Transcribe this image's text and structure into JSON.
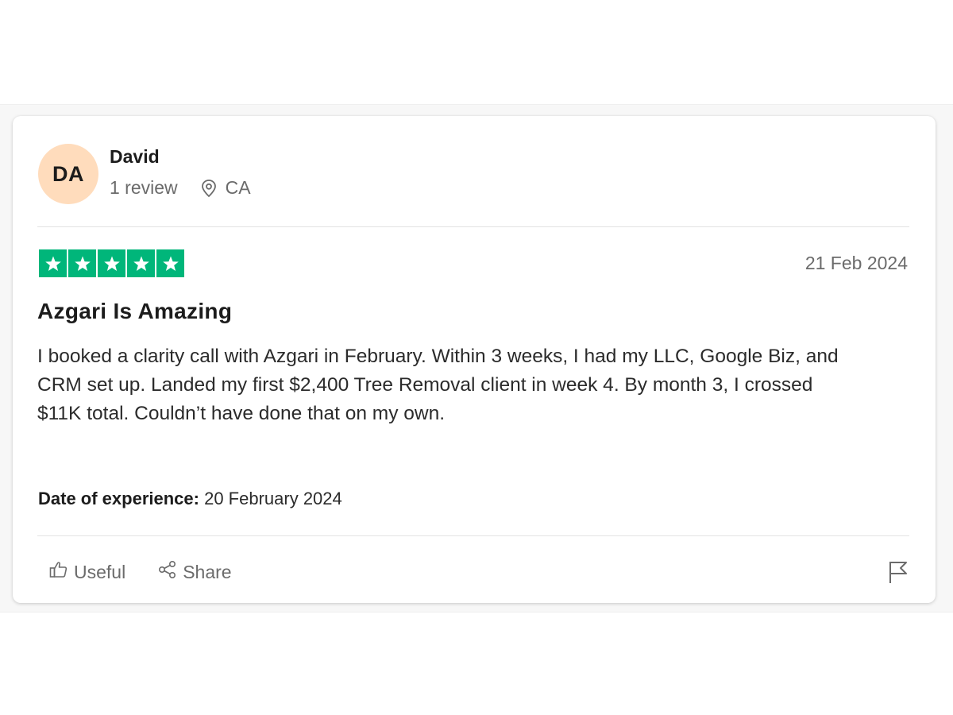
{
  "reviewer": {
    "initials": "DA",
    "name": "David",
    "review_count": "1 review",
    "location": "CA"
  },
  "review": {
    "rating": 5,
    "max_rating": 5,
    "date": "21 Feb 2024",
    "title": "Azgari Is Amazing",
    "body": "I booked a clarity call with Azgari in February. Within 3 weeks, I had my LLC, Google Biz, and CRM set up. Landed my first $2,400 Tree Removal client in week 4. By month 3, I crossed $11K total. Couldn’t have done that on my own.",
    "experience_label": "Date of experience:",
    "experience_date": "20 February 2024"
  },
  "actions": {
    "useful_label": "Useful",
    "share_label": "Share"
  },
  "icons": {
    "location": "location-pin-icon",
    "useful": "thumbs-up-icon",
    "share": "share-icon",
    "flag": "flag-icon",
    "star": "star-icon"
  },
  "colors": {
    "star_green": "#00b67a",
    "avatar_bg": "#ffdcbc",
    "muted_text": "#6b6b6b"
  }
}
